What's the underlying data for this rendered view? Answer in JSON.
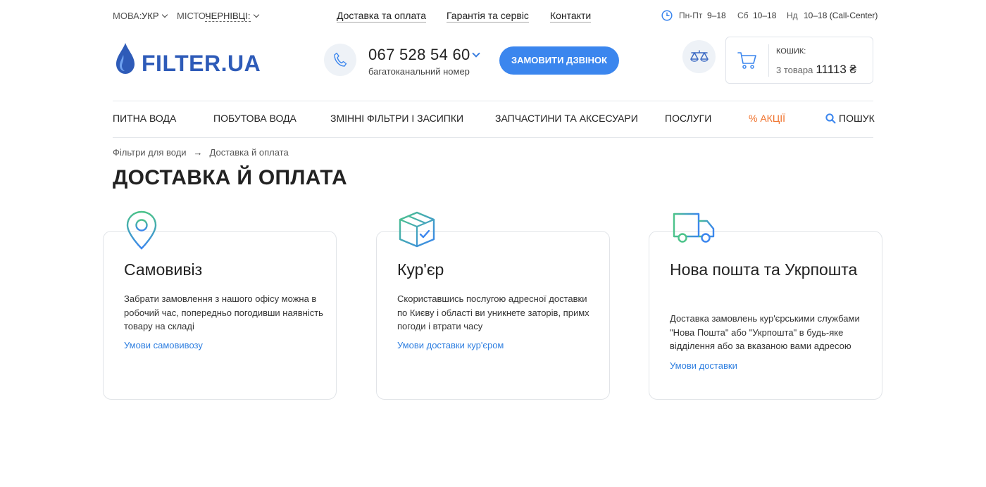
{
  "topbar": {
    "lang_label": "МОВА:",
    "lang_value": "УКР",
    "city_label": "МІСТО:",
    "city_value": "ЧЕРНІВЦІ:",
    "links": [
      "Доставка та оплата",
      "Гарантія та сервіс",
      "Контакти"
    ],
    "hours": {
      "weekdays_label": "Пн-Пт",
      "weekdays_value": "9–18",
      "sat_label": "Сб",
      "sat_value": "10–18",
      "sun_label": "Нд",
      "sun_value": "10–18 (Call-Center)"
    }
  },
  "header": {
    "logo_text": "FILTER",
    "logo_suffix": ".UA",
    "phone_number": "067 528 54 60",
    "phone_sub": "багатоканальний номер",
    "callback_label": "ЗАМОВИТИ ДЗВІНОК",
    "cart": {
      "label": "КОШИК:",
      "count": "3 товара",
      "sum": "11113 ₴"
    }
  },
  "nav": {
    "items": [
      "ПИТНА ВОДА",
      "ПОБУТОВА ВОДА",
      "ЗМІННІ ФІЛЬТРИ І ЗАСИПКИ",
      "ЗАПЧАСТИНИ ТА АКСЕСУАРИ",
      "ПОСЛУГИ"
    ],
    "promo": "% АКЦІЇ",
    "search": "ПОШУК"
  },
  "breadcrumb": [
    "Фільтри для води",
    "Доставка й оплата"
  ],
  "page_title": "ДОСТАВКА Й ОПЛАТА",
  "cards": [
    {
      "icon": "location-pin-icon",
      "title": "Самовивіз",
      "desc": "Забрати замовлення з нашого офісу можна в робочий час, попередньо погодивши наявність товару на складі",
      "link": "Умови самовивозу"
    },
    {
      "icon": "box-icon",
      "title": "Кур'єр",
      "desc": "Скориставшись послугою адресної доставки по Києву і області ви уникнете заторів, примх погоди і втрати часу",
      "link": "Умови доставки кур'єром"
    },
    {
      "icon": "truck-icon",
      "title": "Нова пошта та Укрпошта",
      "desc": "Доставка замовлень кур'єрськими службами \"Нова Пошта\" або \"Укрпошта\" в будь-яке відділення або за вказаною вами адресою",
      "link": "Умови доставки"
    }
  ],
  "colors": {
    "accent": "#3b86ee",
    "link": "#2f7fe0",
    "promo": "#f07029",
    "logo": "#2e5bb8"
  }
}
